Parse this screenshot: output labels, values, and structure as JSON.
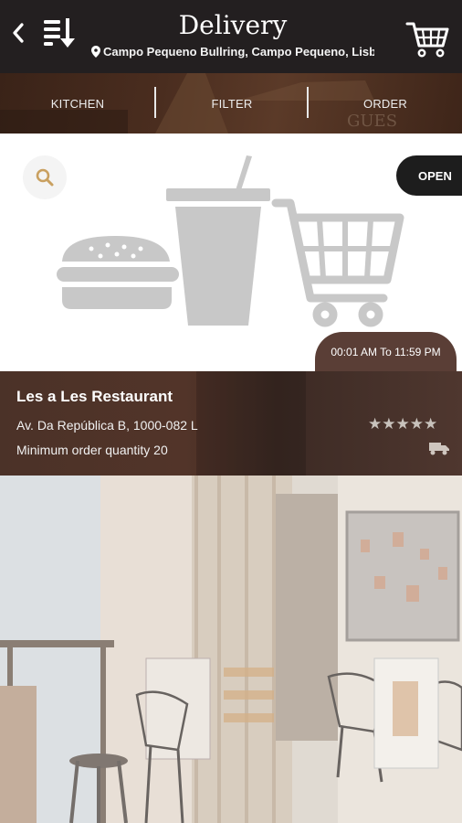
{
  "header": {
    "title": "Delivery",
    "location": "Campo Pequeno Bullring, Campo Pequeno, Lisbon, Por..."
  },
  "tabs": [
    {
      "label": "KITCHEN"
    },
    {
      "label": "FILTER"
    },
    {
      "label": "ORDER"
    }
  ],
  "status": {
    "open_label": "OPEN"
  },
  "hours": "00:01 AM To 11:59 PM",
  "restaurant": {
    "name": "Les a Les Restaurant",
    "address": "Av. Da República B, 1000-082 L...",
    "min_order": "Minimum order quantity 20",
    "rating": 5,
    "rating_stars": "★★★★★"
  },
  "icons": {
    "back": "chevron-left-icon",
    "sort": "sort-icon",
    "location": "location-pin-icon",
    "cart": "shopping-cart-icon",
    "search": "search-icon",
    "delivery": "delivery-truck-icon"
  },
  "colors": {
    "header_bg": "#231f20",
    "open_badge": "#1d1d1d",
    "hours_badge": "#5a3e36",
    "info_bg": "#4b3228",
    "search_icon": "#c9a060",
    "illustration": "#c8c8c8"
  }
}
